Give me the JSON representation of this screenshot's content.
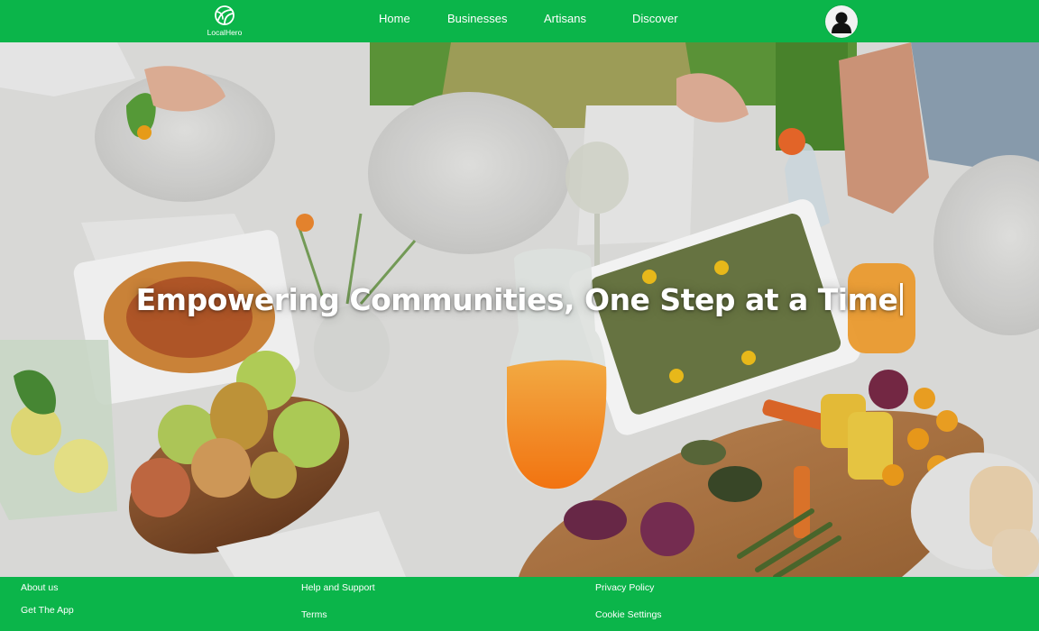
{
  "app": {
    "brand_name": "LocalHero",
    "accent_color": "#0bb54a",
    "logo_icon": "leaf-ball-icon"
  },
  "nav": {
    "items": [
      {
        "label": "Home"
      },
      {
        "label": "Businesses"
      },
      {
        "label": "Artisans"
      },
      {
        "label": "Discover"
      }
    ],
    "avatar_icon": "user-silhouette-icon"
  },
  "hero": {
    "title": "Empowering Communities, One Step at a Time",
    "background": "outdoor-dinner-table-photo"
  },
  "footer": {
    "links": [
      {
        "label": "About us"
      },
      {
        "label": "Get The App"
      },
      {
        "label": "Help and Support"
      },
      {
        "label": "Terms"
      },
      {
        "label": "Privacy Policy"
      },
      {
        "label": "Cookie Settings"
      }
    ]
  }
}
